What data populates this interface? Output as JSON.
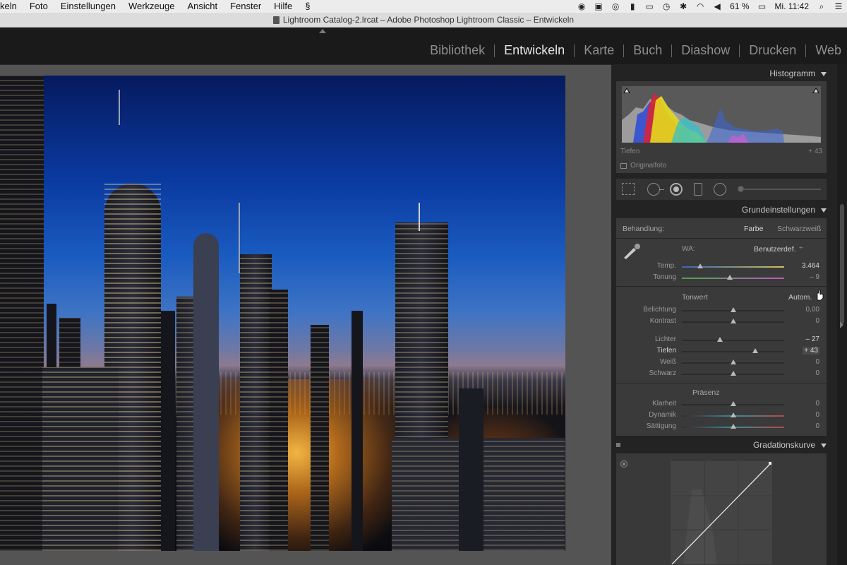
{
  "menubar": {
    "items": [
      "keln",
      "Foto",
      "Einstellungen",
      "Werkzeuge",
      "Ansicht",
      "Fenster",
      "Hilfe"
    ],
    "battery": "61 %",
    "clock": "Mi. 11:42"
  },
  "window": {
    "title": "Lightroom Catalog-2.lrcat – Adobe Photoshop Lightroom Classic – Entwickeln"
  },
  "modules": [
    {
      "label": "Bibliothek",
      "active": false
    },
    {
      "label": "Entwickeln",
      "active": true
    },
    {
      "label": "Karte",
      "active": false
    },
    {
      "label": "Buch",
      "active": false
    },
    {
      "label": "Diashow",
      "active": false
    },
    {
      "label": "Drucken",
      "active": false
    },
    {
      "label": "Web",
      "active": false
    }
  ],
  "histogram": {
    "header": "Histogramm",
    "caption": "Tiefen",
    "value": "+ 43",
    "original_label": "Originalfoto"
  },
  "basic": {
    "header": "Grundeinstellungen",
    "treatment_label": "Behandlung:",
    "treatment_color": "Farbe",
    "treatment_bw": "Schwarzweiß",
    "wb_label": "WA:",
    "wb_value": "Benutzerdef.",
    "wb_arrow": "÷",
    "temp": {
      "label": "Temp.",
      "value": "3.464",
      "pos": 0.18
    },
    "tint": {
      "label": "Tonung",
      "value": "– 9",
      "pos": 0.47
    },
    "tone_title": "Tonwert",
    "auto_label": "Autom.",
    "exposure": {
      "label": "Belichtung",
      "value": "0,00",
      "pos": 0.5
    },
    "contrast": {
      "label": "Kontrast",
      "value": "0",
      "pos": 0.5
    },
    "highlights": {
      "label": "Lichter",
      "value": "– 27",
      "pos": 0.37
    },
    "shadows": {
      "label": "Tiefen",
      "value": "+ 43",
      "pos": 0.72
    },
    "whites": {
      "label": "Weiß",
      "value": "0",
      "pos": 0.5
    },
    "blacks": {
      "label": "Schwarz",
      "value": "0",
      "pos": 0.5
    },
    "presence_title": "Präsenz",
    "clarity": {
      "label": "Klarheit",
      "value": "0",
      "pos": 0.5
    },
    "vibrance": {
      "label": "Dynamik",
      "value": "0",
      "pos": 0.5
    },
    "saturation": {
      "label": "Sättigung",
      "value": "0",
      "pos": 0.5
    }
  },
  "tone_curve": {
    "header": "Gradationskurve"
  },
  "icons": [
    "apple-menu-icon",
    "search-icon",
    "wifi-icon",
    "volume-icon",
    "battery-icon",
    "list-icon",
    "eyedropper-icon",
    "crop-icon",
    "spot-removal-icon",
    "red-eye-icon",
    "graduated-filter-icon",
    "radial-filter-icon",
    "target-adjust-icon",
    "pointer-cursor-icon"
  ]
}
